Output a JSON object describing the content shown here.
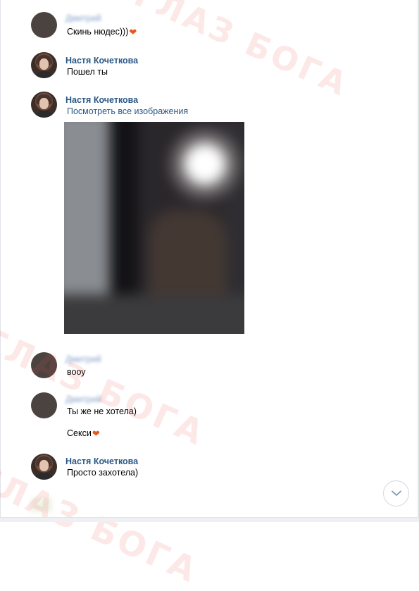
{
  "watermark": {
    "text": "ГЛАЗ БОГА"
  },
  "messages": [
    {
      "author": "Дмитрий",
      "author_blurred": true,
      "lines": [
        "Скинь нюдес)))"
      ],
      "heart": "❤"
    },
    {
      "author": "Настя Кочеткова",
      "lines": [
        "Пошел ты"
      ]
    },
    {
      "author": "Настя Кочеткова",
      "link": "Посмотреть все изображения",
      "attachment": "photo"
    },
    {
      "author": "Дмитрий",
      "author_blurred": true,
      "lines": [
        "вооу"
      ]
    },
    {
      "author": "Дмитрий",
      "author_blurred": true,
      "lines": [
        "Ты же не хотела)",
        "Секси"
      ],
      "heart": "❤"
    },
    {
      "author": "Настя Кочеткова",
      "lines": [
        "Просто захотела)"
      ]
    }
  ],
  "scroll_button": {
    "icon": "chevron-down-icon"
  },
  "colors": {
    "author_name": "#2a5885",
    "heart": "#e8571f",
    "watermark": "#f05050"
  }
}
